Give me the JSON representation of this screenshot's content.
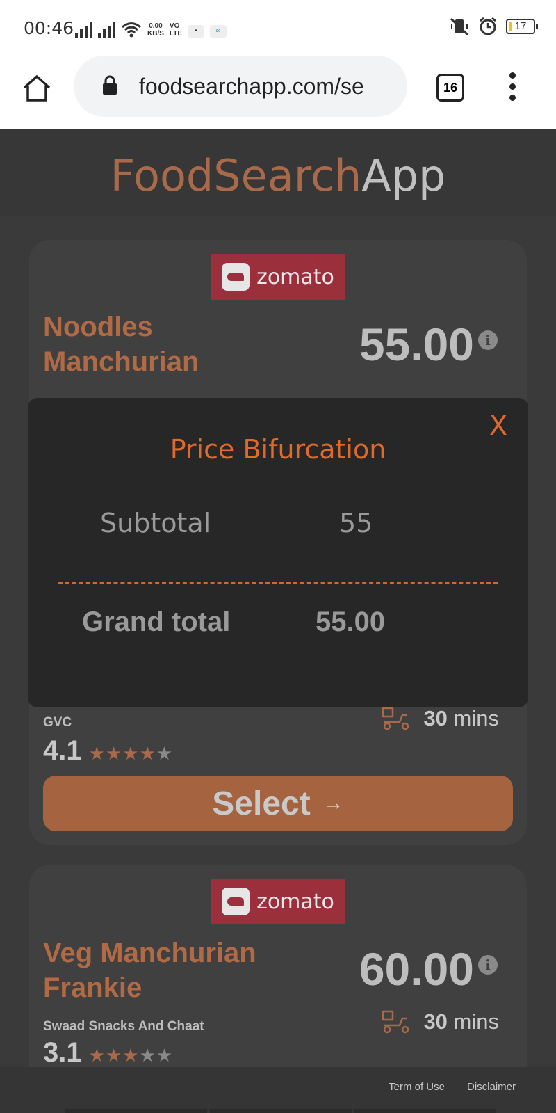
{
  "status_bar": {
    "time": "00:46",
    "net_speed_value": "0.00",
    "net_speed_unit": "KB/S",
    "volte_top": "VO",
    "volte_bottom": "LTE",
    "battery": "17"
  },
  "browser": {
    "url": "foodsearchapp.com/se",
    "tab_count": "16",
    "icons": [
      "home-icon",
      "lock-icon",
      "tabs-icon",
      "more-vert-icon"
    ]
  },
  "header": {
    "title_part1": "FoodSearch",
    "title_part2": "App"
  },
  "cards": [
    {
      "brand": "zomato",
      "dish_line1": "Noodles",
      "dish_line2": "Manchurian",
      "price": "55.00",
      "restaurant": "GVC",
      "delivery_time": "30",
      "delivery_unit": "mins",
      "rating": "4.1",
      "stars_filled": 4,
      "stars_total": 5,
      "select_label": "Select"
    },
    {
      "brand": "zomato",
      "dish_line1": "Veg Manchurian",
      "dish_line2": "Frankie",
      "price": "60.00",
      "restaurant": "Swaad Snacks And Chaat",
      "delivery_time": "30",
      "delivery_unit": "mins",
      "rating": "3.1",
      "stars_filled": 3,
      "stars_total": 5
    }
  ],
  "modal": {
    "close_label": "X",
    "title": "Price Bifurcation",
    "subtotal_label": "Subtotal",
    "subtotal_value": "55",
    "grand_total_label": "Grand total",
    "grand_total_value": "55.00"
  },
  "footer": {
    "terms": "Term of Use",
    "disclaimer": "Disclaimer"
  },
  "colors": {
    "accent": "#a86a4a",
    "modal_accent": "#e06a2c",
    "zomato": "#9c2f3c",
    "background": "#3a3a3a"
  }
}
